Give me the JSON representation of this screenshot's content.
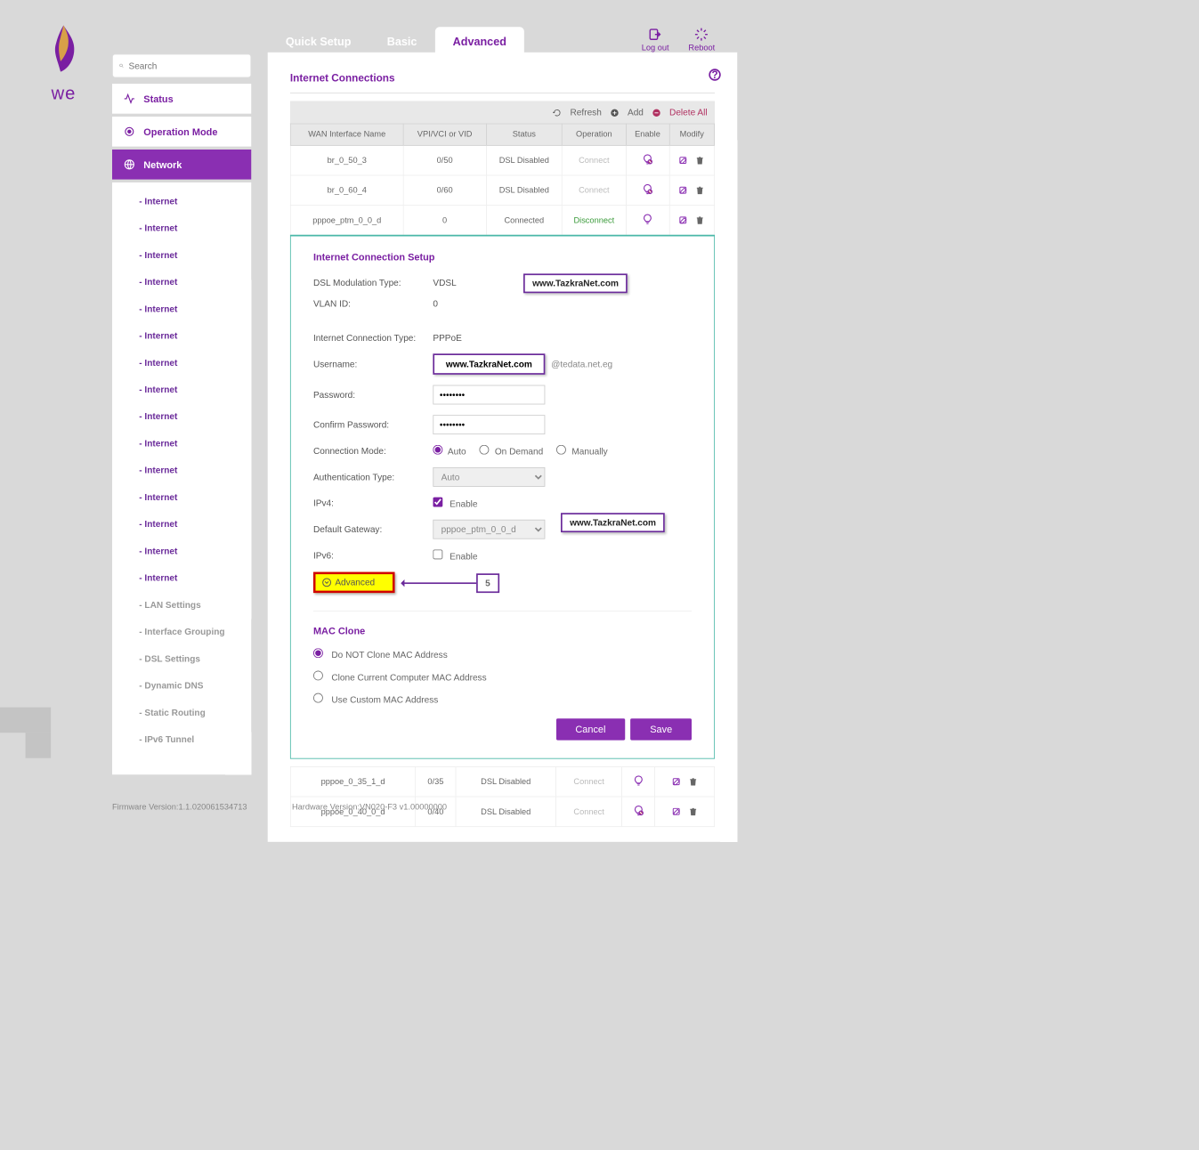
{
  "brand": "we",
  "search": {
    "placeholder": "Search"
  },
  "nav": {
    "status": "Status",
    "operation": "Operation Mode",
    "network": "Network",
    "sub": [
      "Internet",
      "Internet",
      "Internet",
      "Internet",
      "Internet",
      "Internet",
      "Internet",
      "Internet",
      "Internet",
      "Internet",
      "Internet",
      "Internet",
      "Internet",
      "Internet",
      "Internet"
    ],
    "sub_dim": [
      "LAN Settings",
      "Interface Grouping",
      "DSL Settings",
      "Dynamic DNS",
      "Static Routing",
      "IPv6 Tunnel"
    ]
  },
  "tabs": {
    "quick": "Quick Setup",
    "basic": "Basic",
    "advanced": "Advanced"
  },
  "top_actions": {
    "logout": "Log out",
    "reboot": "Reboot"
  },
  "page": {
    "title": "Internet Connections"
  },
  "table_actions": {
    "refresh": "Refresh",
    "add": "Add",
    "delete_all": "Delete All"
  },
  "table": {
    "headers": [
      "WAN Interface Name",
      "VPI/VCI or VID",
      "Status",
      "Operation",
      "Enable",
      "Modify"
    ],
    "rows": [
      {
        "name": "br_0_50_3",
        "vpi": "0/50",
        "status": "DSL Disabled",
        "op": "Connect",
        "enabled": false
      },
      {
        "name": "br_0_60_4",
        "vpi": "0/60",
        "status": "DSL Disabled",
        "op": "Connect",
        "enabled": false
      },
      {
        "name": "pppoe_ptm_0_0_d",
        "vpi": "0",
        "status": "Connected",
        "op": "Disconnect",
        "enabled": true
      },
      {
        "name": "pppoe_0_35_1_d",
        "vpi": "0/35",
        "status": "DSL Disabled",
        "op": "Connect",
        "enabled": true
      },
      {
        "name": "pppoe_0_40_0_d",
        "vpi": "0/40",
        "status": "DSL Disabled",
        "op": "Connect",
        "enabled": false
      }
    ]
  },
  "setup": {
    "title": "Internet Connection Setup",
    "dsl_label": "DSL Modulation Type:",
    "dsl": "VDSL",
    "vlan_label": "VLAN ID:",
    "vlan": "0",
    "conn_type_label": "Internet Connection Type:",
    "conn_type": "PPPoE",
    "user_label": "Username:",
    "user": "www.TazkraNet.com",
    "user_suffix": "@tedata.net.eg",
    "pass_label": "Password:",
    "pass": "••••••••",
    "pass2_label": "Confirm Password:",
    "pass2": "••••••••",
    "mode_label": "Connection Mode:",
    "mode_opts": [
      "Auto",
      "On Demand",
      "Manually"
    ],
    "auth_label": "Authentication Type:",
    "auth": "Auto",
    "ipv4_label": "IPv4:",
    "enable": "Enable",
    "gw_label": "Default Gateway:",
    "gw": "pppoe_ptm_0_0_d",
    "ipv6_label": "IPv6:",
    "adv": "Advanced",
    "mac_title": "MAC Clone",
    "mac_opts": [
      "Do NOT Clone MAC Address",
      "Clone Current Computer MAC Address",
      "Use Custom MAC Address"
    ],
    "cancel": "Cancel",
    "save": "Save"
  },
  "watermarks": {
    "w": "www.TazkraNet.com",
    "step": "5"
  },
  "footer": {
    "fw": "Firmware Version:1.1.020061534713",
    "hw": "Hardware Version:VN020-F3 v1.00000000"
  }
}
